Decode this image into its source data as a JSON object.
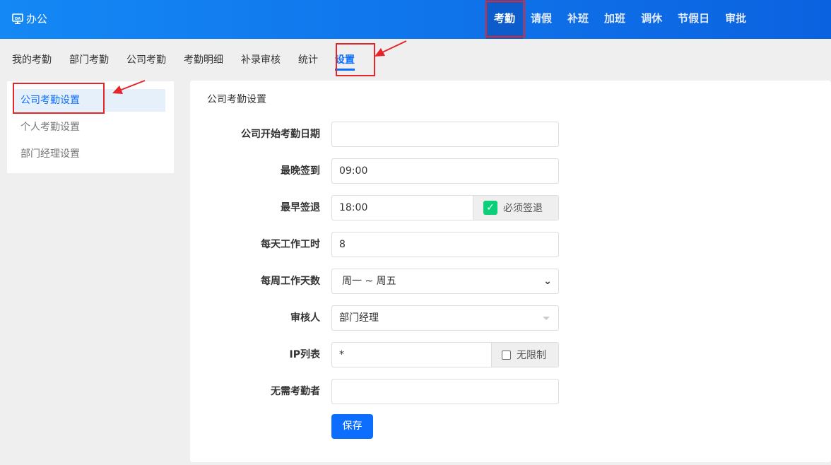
{
  "header": {
    "brand": "办公",
    "brand_icon": "monitor-oa-icon",
    "nav": [
      "考勤",
      "请假",
      "补班",
      "加班",
      "调休",
      "节假日",
      "审批"
    ],
    "active_nav": "考勤"
  },
  "subnav": {
    "tabs": [
      "我的考勤",
      "部门考勤",
      "公司考勤",
      "考勤明细",
      "补录审核",
      "统计",
      "设置"
    ],
    "active": "设置"
  },
  "sidebar": {
    "items": [
      "公司考勤设置",
      "个人考勤设置",
      "部门经理设置"
    ],
    "active": "公司考勤设置"
  },
  "form": {
    "title": "公司考勤设置",
    "start_date": {
      "label": "公司开始考勤日期",
      "value": ""
    },
    "latest_checkin": {
      "label": "最晚签到",
      "value": "09:00"
    },
    "earliest_checkout": {
      "label": "最早签退",
      "value": "18:00",
      "checkbox_label": "必须签退",
      "checked": true
    },
    "daily_hours": {
      "label": "每天工作工时",
      "value": "8"
    },
    "weekly_days": {
      "label": "每周工作天数",
      "value": "周一 ~ 周五"
    },
    "reviewer": {
      "label": "审核人",
      "value": "部门经理"
    },
    "ip_list": {
      "label": "IP列表",
      "value": "*",
      "checkbox_label": "无限制",
      "checked": false
    },
    "exempt": {
      "label": "无需考勤者",
      "value": ""
    },
    "save_label": "保存"
  },
  "annotation_color": "#e4262b"
}
